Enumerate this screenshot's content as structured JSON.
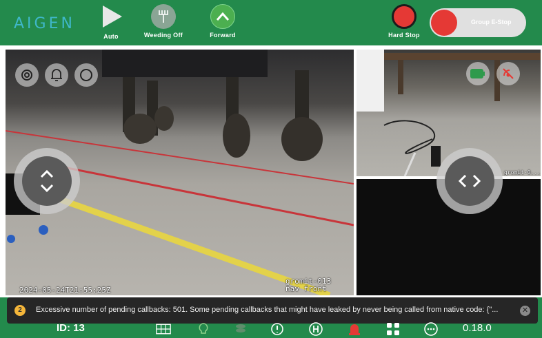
{
  "header": {
    "logo_text": "AIGEN",
    "auto_label": "Auto",
    "weeding_label": "Weeding Off",
    "forward_label": "Forward",
    "hard_stop_label": "Hard Stop",
    "group_estop_label": "Group E-Stop"
  },
  "cameras": {
    "main_timestamp": "2024-05-24T21:55:25Z",
    "main_label": "gromit-013\nnav front",
    "tr_label": "gromit-0..."
  },
  "toast": {
    "count": "2",
    "message": "Excessive number of pending callbacks: 501. Some pending callbacks that might have leaked by never being called from native code: {\"...",
    "close_symbol": "✕"
  },
  "footer": {
    "robot_id": "ID: 13",
    "version": "0.18.0"
  },
  "icons": [
    "auto-icon",
    "weeding-icon",
    "forward-icon",
    "hard-stop-icon",
    "settings-icon",
    "bell-icon",
    "compass-icon",
    "battery-icon",
    "gps-off-icon",
    "grid-icon",
    "bulb-icon",
    "layers-icon",
    "tire-pressure-icon",
    "hitch-icon",
    "alarm-icon",
    "apps-icon",
    "more-icon"
  ],
  "colors": {
    "brand_green": "#238a4c",
    "logo": "#3fb7c9",
    "stop_red": "#e53935",
    "battery": "#2e9a4c"
  }
}
